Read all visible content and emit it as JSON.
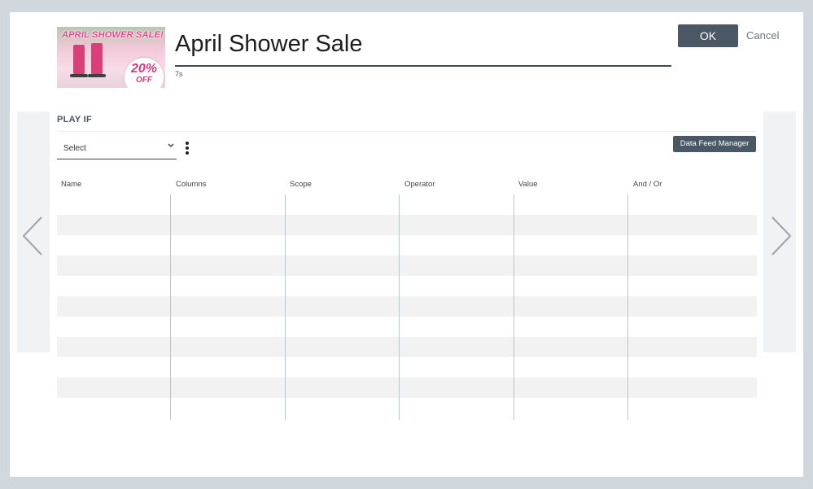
{
  "header": {
    "title": "April Shower Sale",
    "duration": "7s",
    "ok_label": "OK",
    "cancel_label": "Cancel"
  },
  "thumbnail": {
    "banner_text": "APRIL SHOWER SALE!",
    "discount": "20%",
    "discount_suffix": "OFF"
  },
  "play_if": {
    "label": "PLAY IF",
    "select_value": "Select",
    "data_feed_button": "Data Feed Manager"
  },
  "table": {
    "columns": [
      "Name",
      "Columns",
      "Scope",
      "Operator",
      "Value",
      "And / Or"
    ],
    "rows": []
  },
  "colors": {
    "primary_button": "#4a5866",
    "backdrop": "#d0d8de",
    "row_shade": "#f2f2f2"
  },
  "icons": {
    "prev": "chevron-left-icon",
    "next": "chevron-right-icon",
    "select_caret": "chevron-down-icon",
    "more": "kebab-menu-icon"
  }
}
